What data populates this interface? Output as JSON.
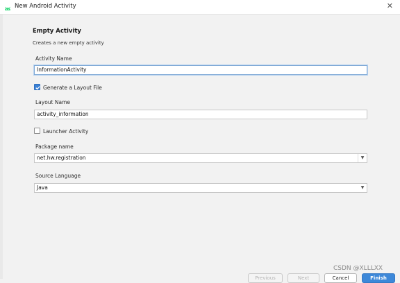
{
  "window": {
    "title": "New Android Activity"
  },
  "header": {
    "heading": "Empty Activity",
    "subheading": "Creates a new empty activity"
  },
  "form": {
    "activity_name": {
      "label": "Activity Name",
      "value": "InformationActivity"
    },
    "generate_layout": {
      "label": "Generate a Layout File",
      "checked": true
    },
    "layout_name": {
      "label": "Layout Name",
      "value": "activity_information"
    },
    "launcher_activity": {
      "label": "Launcher Activity",
      "checked": false
    },
    "package_name": {
      "label": "Package name",
      "value": "net.hw.registration"
    },
    "source_language": {
      "label": "Source Language",
      "value": "Java"
    }
  },
  "footer": {
    "previous_label": "Previous",
    "next_label": "Next",
    "cancel_label": "Cancel",
    "finish_label": "Finish"
  },
  "watermark": "CSDN @XLLLXX",
  "colors": {
    "accent": "#3d88d9",
    "android_green": "#3ddc84",
    "focus_border": "#7fa9d6"
  },
  "icons": {
    "app": "android-icon",
    "close": "close-icon",
    "dropdown": "chevron-down-icon",
    "check": "checkmark-icon"
  }
}
